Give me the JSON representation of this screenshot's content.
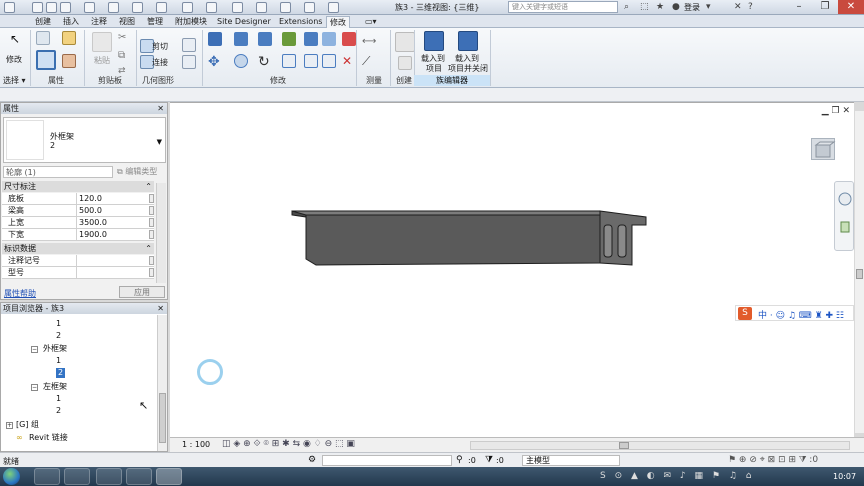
{
  "titlebar": {
    "title": "族3 - 三维视图: {三维}",
    "search_placeholder": "键入关键字或短语",
    "login": "登录",
    "minimize": "–",
    "restore": "❐",
    "close": "✕"
  },
  "tabs": [
    {
      "label": "创建"
    },
    {
      "label": "插入"
    },
    {
      "label": "注释"
    },
    {
      "label": "视图"
    },
    {
      "label": "管理"
    },
    {
      "label": "附加模块"
    },
    {
      "label": "Site Designer"
    },
    {
      "label": "Extensions"
    },
    {
      "label": "修改"
    }
  ],
  "ribbon": {
    "modify_label": "修改",
    "select_label": "选择 ▾",
    "properties_label": "属性",
    "clipboard_label": "剪贴板",
    "paste_label": "粘贴",
    "cut_label": "剪切",
    "join_label": "连接",
    "geometry_label": "几何图形",
    "modify_panel_label": "修改",
    "measure_label": "测量",
    "create_label": "创建",
    "load_into_project_label": "载入到",
    "load_into_project_label2": "项目",
    "load_close_label": "载入到",
    "load_close_label2": "项目并关闭",
    "family_editor_label": "族编辑器"
  },
  "properties": {
    "header": "属性",
    "type_name": "外框架",
    "type_number": "2",
    "profile_select": "轮廓 (1)",
    "edit_type": "编辑类型",
    "sections": {
      "dimensions": "尺寸标注",
      "identity": "标识数据"
    },
    "rows": [
      {
        "key": "底板",
        "value": "120.0"
      },
      {
        "key": "梁高",
        "value": "500.0"
      },
      {
        "key": "上宽",
        "value": "3500.0"
      },
      {
        "key": "下宽",
        "value": "1900.0"
      },
      {
        "key": "注释记号",
        "value": ""
      },
      {
        "key": "型号",
        "value": ""
      }
    ],
    "help_link": "属性帮助",
    "apply": "应用"
  },
  "browser": {
    "header": "项目浏览器 - 族3",
    "items": [
      {
        "label": "1"
      },
      {
        "label": "2"
      },
      {
        "label": "外框架"
      },
      {
        "label": "1"
      },
      {
        "label": "2"
      },
      {
        "label": "左框架"
      },
      {
        "label": "1"
      },
      {
        "label": "2"
      },
      {
        "label": "组"
      },
      {
        "label": "Revit 链接"
      }
    ]
  },
  "viewctl": {
    "scale": "1 : 100"
  },
  "statusbar": {
    "text": "就绪",
    "count1": ":0",
    "count2": ":0",
    "model": "主模型"
  },
  "taskbar": {
    "clock": "10:07"
  },
  "colors": {
    "accent": "#cbe3f7",
    "model_fill": "#5a5a5a",
    "model_edge": "#1e1e1e"
  }
}
